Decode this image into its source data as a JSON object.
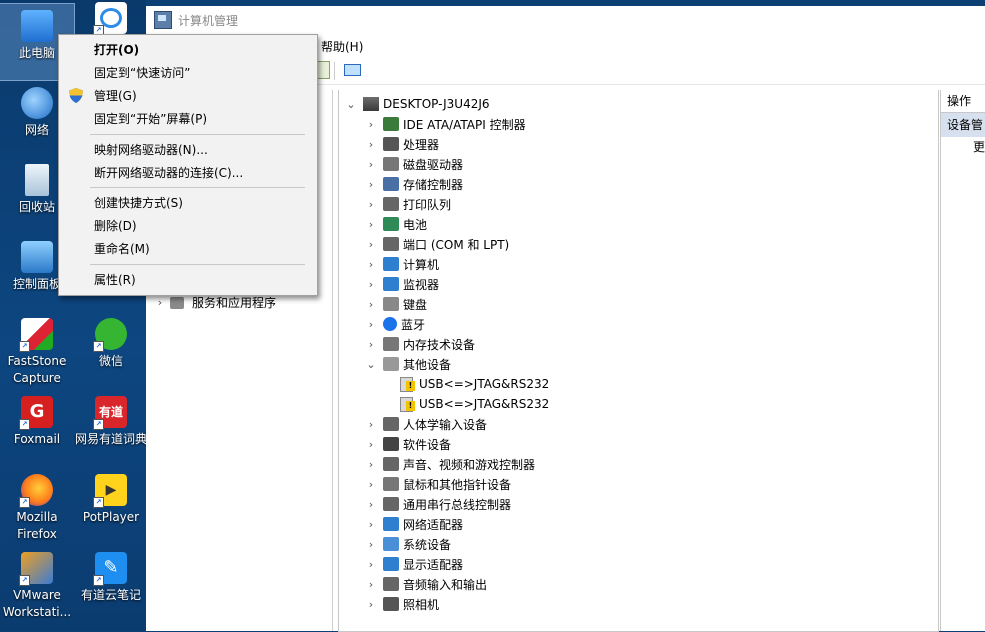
{
  "desktop": {
    "icons": [
      {
        "label": "此电脑",
        "icon": "computer-icon"
      },
      {
        "label": "网络",
        "icon": "network-icon"
      },
      {
        "label": "回收站",
        "icon": "recycle-bin-icon"
      },
      {
        "label": "控制面板",
        "icon": "control-panel-icon"
      },
      {
        "label": "FastStone Capture",
        "icon": "faststone-icon"
      },
      {
        "label": "Foxmail",
        "icon": "foxmail-icon"
      },
      {
        "label": "Mozilla Firefox",
        "icon": "firefox-icon"
      },
      {
        "label": "VMware Workstati...",
        "icon": "vmware-icon"
      },
      {
        "label": "",
        "icon": "baidu-netdisk-icon"
      },
      {
        "label": "微信",
        "icon": "wechat-icon"
      },
      {
        "label": "网易有道词典",
        "icon": "youdao-dict-icon"
      },
      {
        "label": "PotPlayer",
        "icon": "potplayer-icon"
      },
      {
        "label": "有道云笔记",
        "icon": "youdao-note-icon"
      }
    ]
  },
  "window": {
    "title": "计算机管理",
    "menu": {
      "help": "帮助(H)"
    },
    "left_tree": {
      "services": "服务和应用程序"
    },
    "device_tree": {
      "root": "DESKTOP-J3U42J6",
      "categories": [
        {
          "label": "IDE ATA/ATAPI 控制器",
          "expanded": false
        },
        {
          "label": "处理器",
          "expanded": false
        },
        {
          "label": "磁盘驱动器",
          "expanded": false
        },
        {
          "label": "存储控制器",
          "expanded": false
        },
        {
          "label": "打印队列",
          "expanded": false
        },
        {
          "label": "电池",
          "expanded": false
        },
        {
          "label": "端口 (COM 和 LPT)",
          "expanded": false
        },
        {
          "label": "计算机",
          "expanded": false
        },
        {
          "label": "监视器",
          "expanded": false
        },
        {
          "label": "键盘",
          "expanded": false
        },
        {
          "label": "蓝牙",
          "expanded": false
        },
        {
          "label": "内存技术设备",
          "expanded": false
        },
        {
          "label": "其他设备",
          "expanded": true
        },
        {
          "label": "USB<=>JTAG&RS232",
          "child": true
        },
        {
          "label": "USB<=>JTAG&RS232",
          "child": true
        },
        {
          "label": "人体学输入设备",
          "expanded": false
        },
        {
          "label": "软件设备",
          "expanded": false
        },
        {
          "label": "声音、视频和游戏控制器",
          "expanded": false
        },
        {
          "label": "鼠标和其他指针设备",
          "expanded": false
        },
        {
          "label": "通用串行总线控制器",
          "expanded": false
        },
        {
          "label": "网络适配器",
          "expanded": false
        },
        {
          "label": "系统设备",
          "expanded": false
        },
        {
          "label": "显示适配器",
          "expanded": false
        },
        {
          "label": "音频输入和输出",
          "expanded": false
        },
        {
          "label": "照相机",
          "expanded": false
        }
      ]
    },
    "actions": {
      "header": "操作",
      "selected": "设备管",
      "more": "更"
    }
  },
  "context_menu": {
    "items": [
      {
        "label": "打开(O)",
        "bold": true
      },
      {
        "label": "固定到“快速访问”"
      },
      {
        "label": "管理(G)",
        "shield": true
      },
      {
        "label": "固定到“开始”屏幕(P)"
      },
      {
        "label": "映射网络驱动器(N)..."
      },
      {
        "label": "断开网络驱动器的连接(C)..."
      },
      {
        "label": "创建快捷方式(S)"
      },
      {
        "label": "删除(D)"
      },
      {
        "label": "重命名(M)"
      },
      {
        "label": "属性(R)"
      }
    ]
  }
}
